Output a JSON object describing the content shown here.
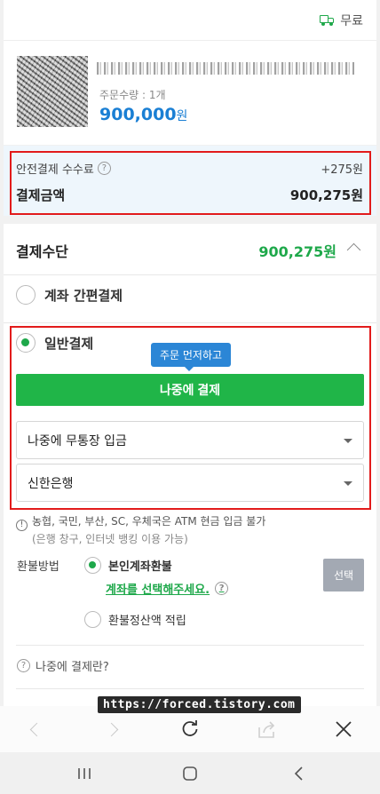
{
  "shipping": {
    "label": "무료",
    "icon": "truck-icon"
  },
  "product": {
    "quantity": "주문수량 : 1개",
    "price": "900,000",
    "price_unit": "원"
  },
  "fee": {
    "label": "안전결제 수수료",
    "value": "+275원",
    "total_label": "결제금액",
    "total_value": "900,275원"
  },
  "payment": {
    "heading": "결제수단",
    "amount": "900,275원",
    "option_simple": "계좌 간편결제",
    "option_general": "일반결제",
    "tooltip": "주문 먼저하고",
    "pay_later_button": "나중에 결제",
    "method_select": "나중에 무통장 입금",
    "bank_select": "신한은행",
    "notice_line1": "농협, 국민, 부산, SC, 우체국은 ATM 현금 입금 불가",
    "notice_line2": "(은행 창구, 인터넷 뱅킹 이용 가능)",
    "refund_label": "환불방법",
    "refund_own": "본인계좌환불",
    "refund_account_link": "계좌를 선택해주세요.",
    "refund_select_button": "선택",
    "refund_credit": "환불정산액 적립",
    "pay_later_question": "나중에 결제란?"
  },
  "watermark": "https://forced.tistory.com",
  "colors": {
    "accent_green": "#20b548",
    "price_blue": "#1a7fd4",
    "highlight_red": "#e21b1b",
    "fee_bg": "#eef6fc"
  }
}
